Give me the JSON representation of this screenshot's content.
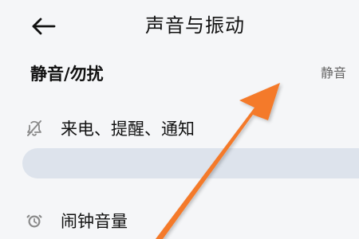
{
  "header": {
    "title": "声音与振动",
    "back_icon": "arrow-left-icon"
  },
  "silent_mode": {
    "title": "静音/勿扰",
    "value": "静音"
  },
  "rows": [
    {
      "label": "来电、提醒、通知",
      "icon": "bell-off-icon",
      "volume_level": 0
    },
    {
      "label": "闹钟音量",
      "icon": "alarm-clock-icon"
    }
  ],
  "colors": {
    "background": "#f5f6f8",
    "slider_track": "#dde3ec",
    "arrow": "#f47a2c"
  }
}
